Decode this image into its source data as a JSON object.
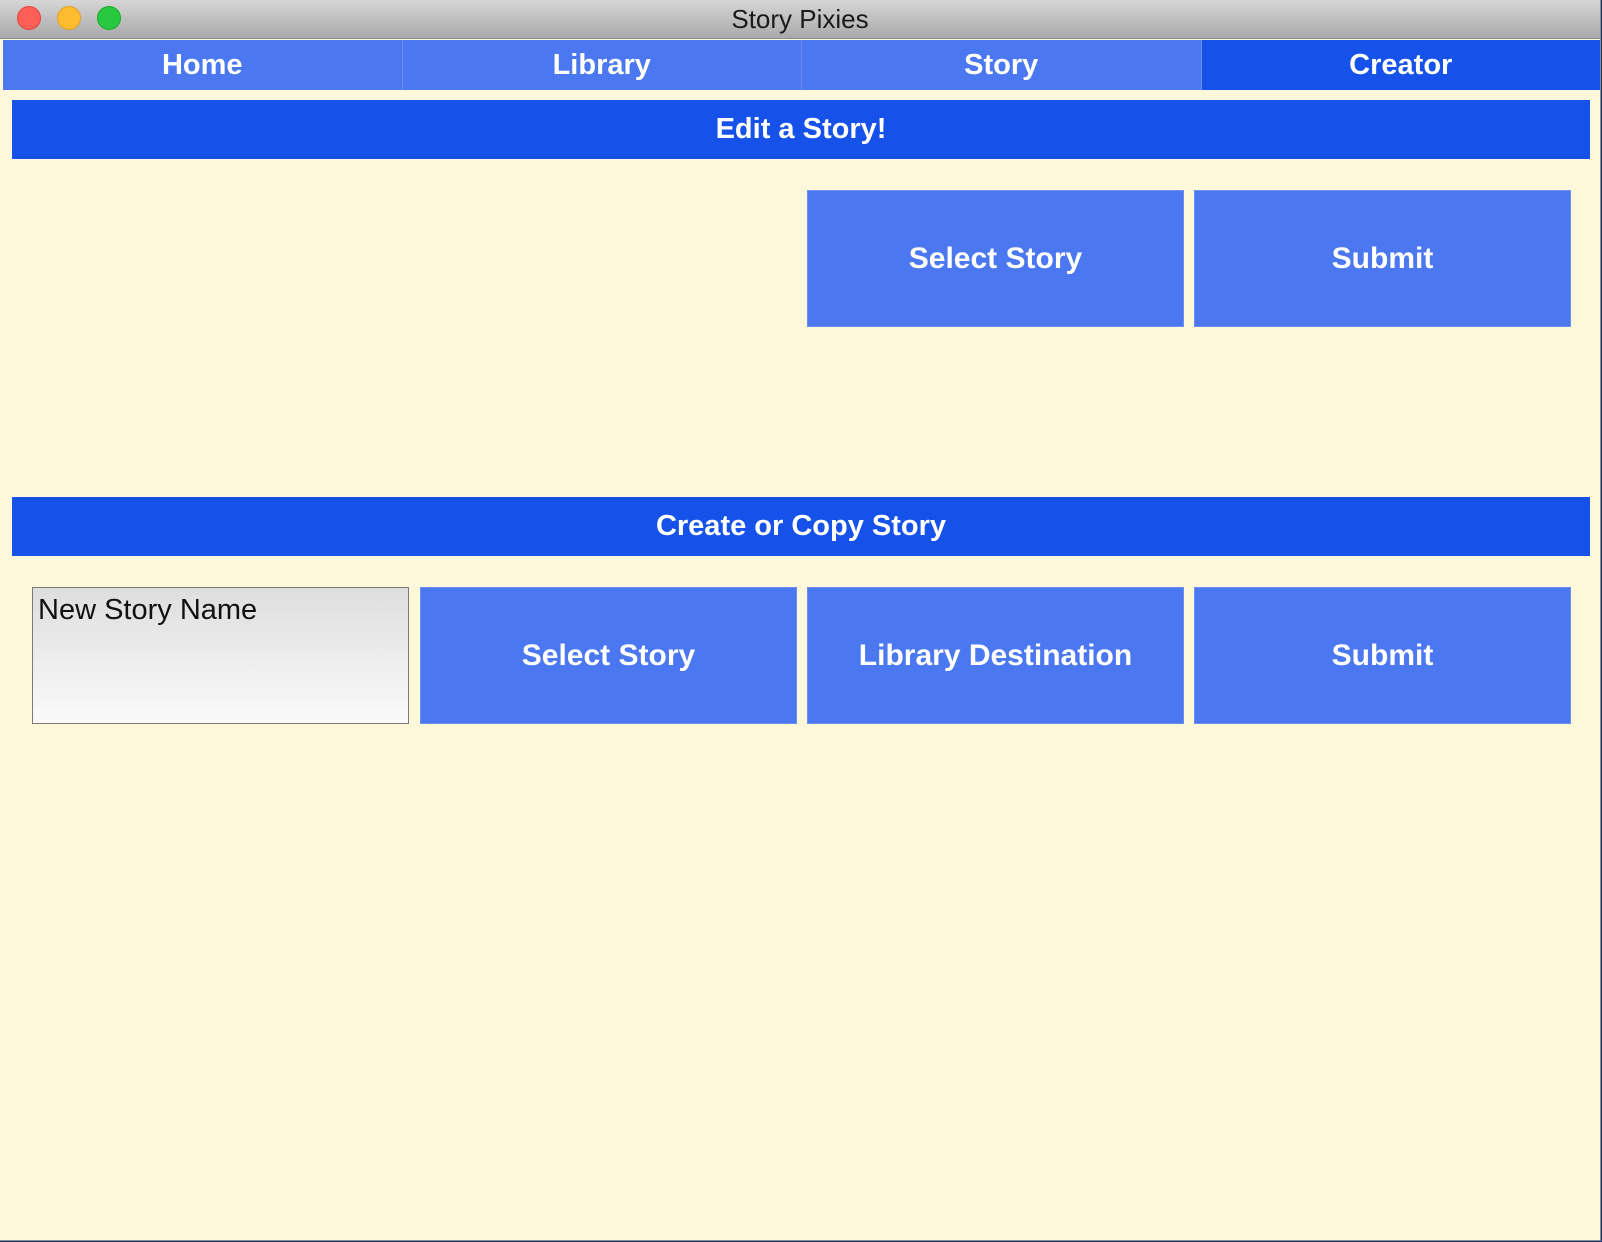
{
  "window": {
    "title": "Story Pixies"
  },
  "tabs": [
    {
      "label": "Home",
      "active": false
    },
    {
      "label": "Library",
      "active": false
    },
    {
      "label": "Story",
      "active": false
    },
    {
      "label": "Creator",
      "active": true
    }
  ],
  "edit_section": {
    "header": "Edit a Story!",
    "select_story_label": "Select Story",
    "submit_label": "Submit"
  },
  "create_section": {
    "header": "Create or Copy Story",
    "name_input": {
      "placeholder": "New Story Name",
      "value": ""
    },
    "select_story_label": "Select Story",
    "library_destination_label": "Library Destination",
    "submit_label": "Submit"
  },
  "colors": {
    "background": "#fef8da",
    "button": "#4b78f1",
    "header": "#1652ea",
    "active_tab": "#1652ea",
    "text_on_blue": "#ffffff"
  }
}
